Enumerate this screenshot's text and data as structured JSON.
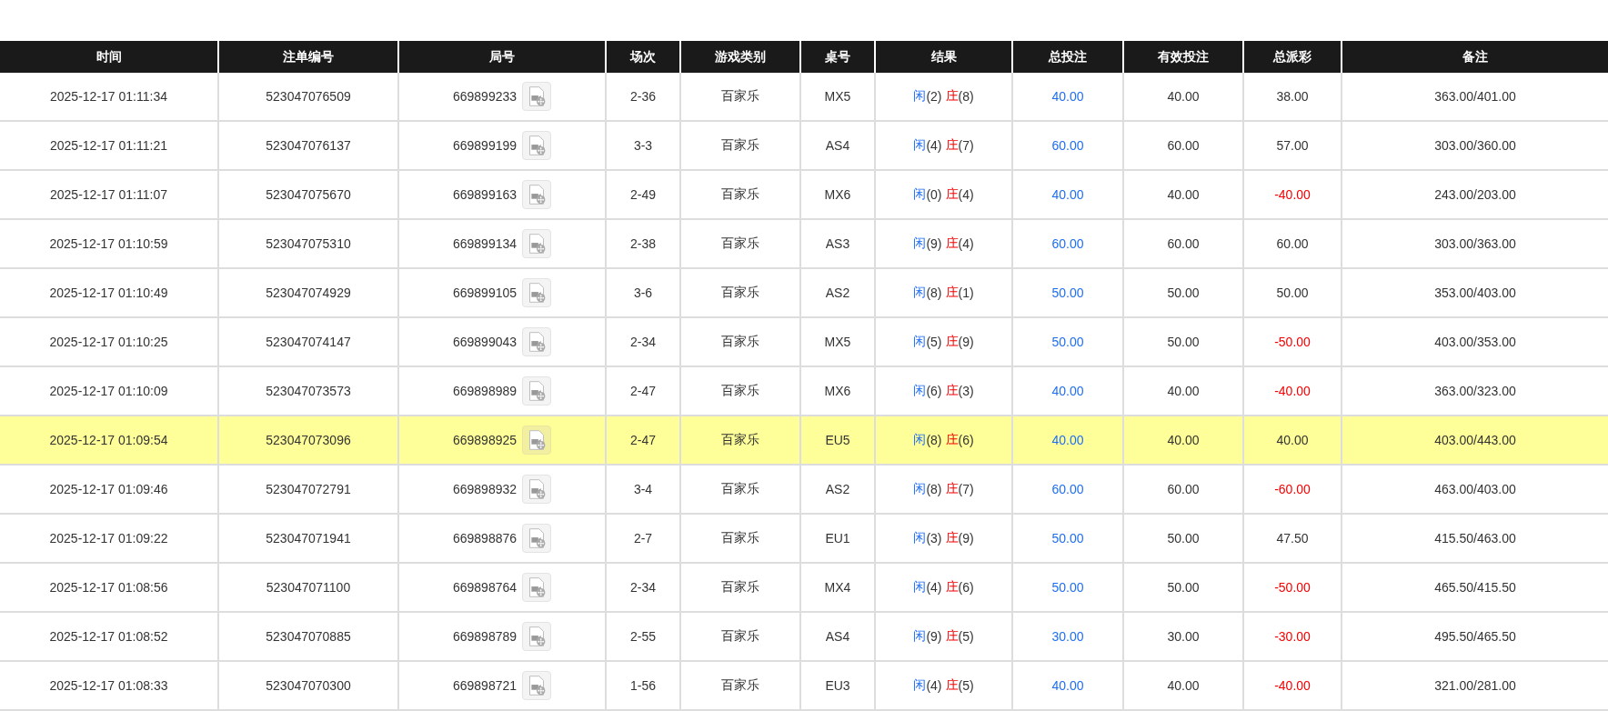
{
  "table": {
    "columns": [
      "时间",
      "注单编号",
      "局号",
      "场次",
      "游戏类别",
      "桌号",
      "结果",
      "总投注",
      "有效投注",
      "总派彩",
      "备注"
    ],
    "rows": [
      {
        "time": "2025-12-17 01:11:34",
        "bet_id": "523047076509",
        "round": "669899233",
        "shoe": "2-36",
        "game": "百家乐",
        "table": "MX5",
        "result": {
          "player": "闲",
          "player_score": "(2)",
          "banker": "庄",
          "banker_score": "(8)"
        },
        "total_bet": "40.00",
        "valid_bet": "40.00",
        "payout": "38.00",
        "payout_negative": false,
        "note": "363.00/401.00",
        "selected": false
      },
      {
        "time": "2025-12-17 01:11:21",
        "bet_id": "523047076137",
        "round": "669899199",
        "shoe": "3-3",
        "game": "百家乐",
        "table": "AS4",
        "result": {
          "player": "闲",
          "player_score": "(4)",
          "banker": "庄",
          "banker_score": "(7)"
        },
        "total_bet": "60.00",
        "valid_bet": "60.00",
        "payout": "57.00",
        "payout_negative": false,
        "note": "303.00/360.00",
        "selected": false
      },
      {
        "time": "2025-12-17 01:11:07",
        "bet_id": "523047075670",
        "round": "669899163",
        "shoe": "2-49",
        "game": "百家乐",
        "table": "MX6",
        "result": {
          "player": "闲",
          "player_score": "(0)",
          "banker": "庄",
          "banker_score": "(4)"
        },
        "total_bet": "40.00",
        "valid_bet": "40.00",
        "payout": "-40.00",
        "payout_negative": true,
        "note": "243.00/203.00",
        "selected": false
      },
      {
        "time": "2025-12-17 01:10:59",
        "bet_id": "523047075310",
        "round": "669899134",
        "shoe": "2-38",
        "game": "百家乐",
        "table": "AS3",
        "result": {
          "player": "闲",
          "player_score": "(9)",
          "banker": "庄",
          "banker_score": "(4)"
        },
        "total_bet": "60.00",
        "valid_bet": "60.00",
        "payout": "60.00",
        "payout_negative": false,
        "note": "303.00/363.00",
        "selected": false
      },
      {
        "time": "2025-12-17 01:10:49",
        "bet_id": "523047074929",
        "round": "669899105",
        "shoe": "3-6",
        "game": "百家乐",
        "table": "AS2",
        "result": {
          "player": "闲",
          "player_score": "(8)",
          "banker": "庄",
          "banker_score": "(1)"
        },
        "total_bet": "50.00",
        "valid_bet": "50.00",
        "payout": "50.00",
        "payout_negative": false,
        "note": "353.00/403.00",
        "selected": false
      },
      {
        "time": "2025-12-17 01:10:25",
        "bet_id": "523047074147",
        "round": "669899043",
        "shoe": "2-34",
        "game": "百家乐",
        "table": "MX5",
        "result": {
          "player": "闲",
          "player_score": "(5)",
          "banker": "庄",
          "banker_score": "(9)"
        },
        "total_bet": "50.00",
        "valid_bet": "50.00",
        "payout": "-50.00",
        "payout_negative": true,
        "note": "403.00/353.00",
        "selected": false
      },
      {
        "time": "2025-12-17 01:10:09",
        "bet_id": "523047073573",
        "round": "669898989",
        "shoe": "2-47",
        "game": "百家乐",
        "table": "MX6",
        "result": {
          "player": "闲",
          "player_score": "(6)",
          "banker": "庄",
          "banker_score": "(3)"
        },
        "total_bet": "40.00",
        "valid_bet": "40.00",
        "payout": "-40.00",
        "payout_negative": true,
        "note": "363.00/323.00",
        "selected": false
      },
      {
        "time": "2025-12-17 01:09:54",
        "bet_id": "523047073096",
        "round": "669898925",
        "shoe": "2-47",
        "game": "百家乐",
        "table": "EU5",
        "result": {
          "player": "闲",
          "player_score": "(8)",
          "banker": "庄",
          "banker_score": "(6)"
        },
        "total_bet": "40.00",
        "valid_bet": "40.00",
        "payout": "40.00",
        "payout_negative": false,
        "note": "403.00/443.00",
        "selected": true
      },
      {
        "time": "2025-12-17 01:09:46",
        "bet_id": "523047072791",
        "round": "669898932",
        "shoe": "3-4",
        "game": "百家乐",
        "table": "AS2",
        "result": {
          "player": "闲",
          "player_score": "(8)",
          "banker": "庄",
          "banker_score": "(7)"
        },
        "total_bet": "60.00",
        "valid_bet": "60.00",
        "payout": "-60.00",
        "payout_negative": true,
        "note": "463.00/403.00",
        "selected": false
      },
      {
        "time": "2025-12-17 01:09:22",
        "bet_id": "523047071941",
        "round": "669898876",
        "shoe": "2-7",
        "game": "百家乐",
        "table": "EU1",
        "result": {
          "player": "闲",
          "player_score": "(3)",
          "banker": "庄",
          "banker_score": "(9)"
        },
        "total_bet": "50.00",
        "valid_bet": "50.00",
        "payout": "47.50",
        "payout_negative": false,
        "note": "415.50/463.00",
        "selected": false
      },
      {
        "time": "2025-12-17 01:08:56",
        "bet_id": "523047071100",
        "round": "669898764",
        "shoe": "2-34",
        "game": "百家乐",
        "table": "MX4",
        "result": {
          "player": "闲",
          "player_score": "(4)",
          "banker": "庄",
          "banker_score": "(6)"
        },
        "total_bet": "50.00",
        "valid_bet": "50.00",
        "payout": "-50.00",
        "payout_negative": true,
        "note": "465.50/415.50",
        "selected": false
      },
      {
        "time": "2025-12-17 01:08:52",
        "bet_id": "523047070885",
        "round": "669898789",
        "shoe": "2-55",
        "game": "百家乐",
        "table": "AS4",
        "result": {
          "player": "闲",
          "player_score": "(9)",
          "banker": "庄",
          "banker_score": "(5)"
        },
        "total_bet": "30.00",
        "valid_bet": "30.00",
        "payout": "-30.00",
        "payout_negative": true,
        "note": "495.50/465.50",
        "selected": false
      },
      {
        "time": "2025-12-17 01:08:33",
        "bet_id": "523047070300",
        "round": "669898721",
        "shoe": "1-56",
        "game": "百家乐",
        "table": "EU3",
        "result": {
          "player": "闲",
          "player_score": "(4)",
          "banker": "庄",
          "banker_score": "(5)"
        },
        "total_bet": "40.00",
        "valid_bet": "40.00",
        "payout": "-40.00",
        "payout_negative": true,
        "note": "321.00/281.00",
        "selected": false
      }
    ]
  }
}
